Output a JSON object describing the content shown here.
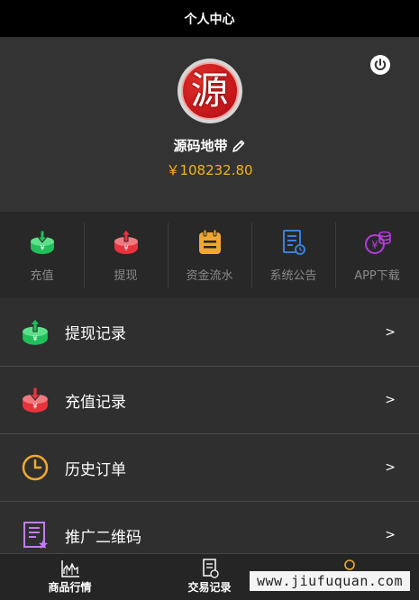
{
  "header": {
    "title": "个人中心"
  },
  "profile": {
    "avatar_char": "源",
    "username": "源码地带",
    "balance": "￥108232.80"
  },
  "quick_actions": [
    {
      "label": "充值",
      "icon": "recharge-icon"
    },
    {
      "label": "提现",
      "icon": "withdraw-icon"
    },
    {
      "label": "资金流水",
      "icon": "clipboard-icon"
    },
    {
      "label": "系统公告",
      "icon": "document-icon"
    },
    {
      "label": "APP下载",
      "icon": "coins-icon"
    }
  ],
  "menu": [
    {
      "label": "提现记录",
      "icon": "withdraw-icon",
      "arrow": ">"
    },
    {
      "label": "充值记录",
      "icon": "recharge-icon",
      "arrow": ">"
    },
    {
      "label": "历史订单",
      "icon": "clock-icon",
      "arrow": ">"
    },
    {
      "label": "推广二维码",
      "icon": "qrcode-doc-icon",
      "arrow": ">"
    }
  ],
  "bottom_nav": [
    {
      "label": "商品行情",
      "icon": "chart-icon"
    },
    {
      "label": "交易记录",
      "icon": "receipt-icon"
    },
    {
      "label": "",
      "icon": "user-icon"
    }
  ],
  "watermark": "www.jiufuquan.com",
  "colors": {
    "balance": "#f5b21b",
    "green": "#1fbf5a",
    "red": "#e8333c",
    "orange": "#f0a830",
    "blue": "#3c7fd9",
    "purple": "#b43cd9",
    "lavender": "#c07ef0"
  }
}
